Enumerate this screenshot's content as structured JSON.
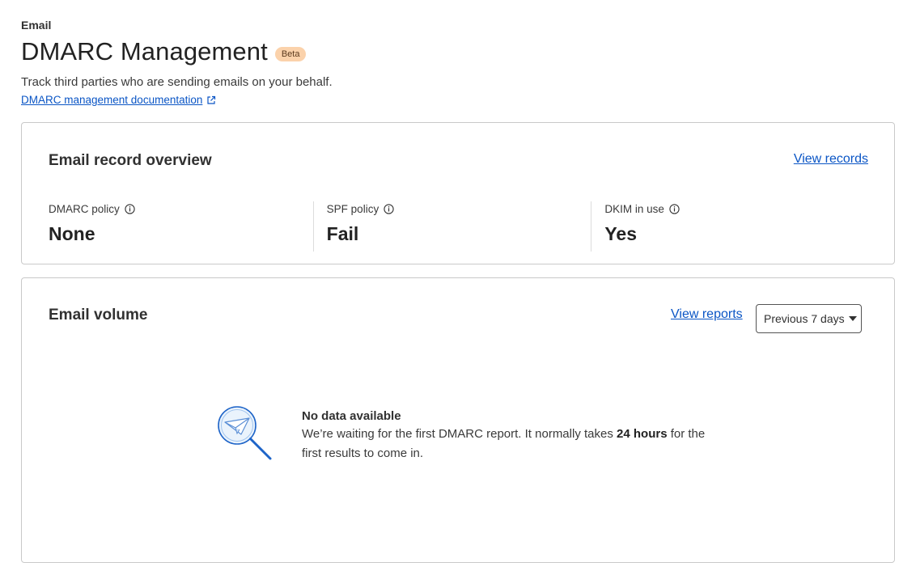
{
  "breadcrumb": "Email",
  "page": {
    "title": "DMARC Management",
    "badge": "Beta",
    "subtitle": "Track third parties who are sending emails on your behalf.",
    "doc_link": "DMARC management documentation"
  },
  "overview": {
    "title": "Email record overview",
    "view_link": "View records",
    "stats": [
      {
        "label": "DMARC policy",
        "value": "None"
      },
      {
        "label": "SPF policy",
        "value": "Fail"
      },
      {
        "label": "DKIM in use",
        "value": "Yes"
      }
    ]
  },
  "volume": {
    "title": "Email volume",
    "view_link": "View reports",
    "period_select": "Previous 7 days",
    "empty": {
      "heading": "No data available",
      "body_before": "We’re waiting for the first DMARC report. It normally takes ",
      "body_bold": "24 hours",
      "body_after": " for the first results to come in."
    }
  },
  "colors": {
    "link": "#0a55c5",
    "badge_bg": "#fbd2ab",
    "border": "#c9c9c9"
  },
  "icons": [
    "external-link-icon",
    "info-icon",
    "caret-down-icon",
    "paper-plane-magnifier-illustration"
  ]
}
